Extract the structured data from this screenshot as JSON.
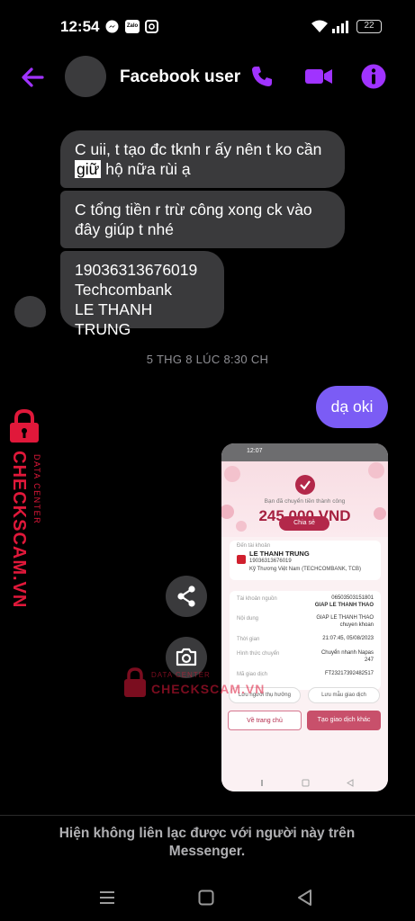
{
  "status_bar": {
    "time": "12:54",
    "battery": "22",
    "icons": [
      "messenger-icon",
      "zalo-icon",
      "instagram-icon",
      "wifi-icon",
      "signal-icon",
      "battery-icon"
    ],
    "zalo_label": "Zalo"
  },
  "header": {
    "contact_name": "Facebook user",
    "accent_color": "#a033ff",
    "icons": [
      "back-arrow-icon",
      "phone-icon",
      "video-camera-icon",
      "info-icon"
    ]
  },
  "messages": {
    "incoming": [
      {
        "text_before": "C uii, t tạo đc tknh r ấy nên t ko cần ",
        "highlight": "giữ",
        "text_after": " hộ nữa rùi ạ"
      },
      {
        "text": "C tổng tiền r trừ công xong ck vào đây giúp t nhé"
      },
      {
        "line1": "19036313676019",
        "line2": "Techcombank",
        "line3": "LE THANH TRUNG"
      }
    ],
    "timestamp": "5 THG 8 LÚC 8:30 CH",
    "outgoing": [
      {
        "text": "dạ oki"
      }
    ],
    "outgoing_color": "#7b5cf5"
  },
  "receipt": {
    "status_time": "12:07",
    "subtitle": "Bạn đã chuyển tiền thành công",
    "amount": "245,000 VND",
    "share_label": "Chia sẻ",
    "to_label": "Đến tài khoản",
    "recipient_name": "LE THANH TRUNG",
    "recipient_account": "19036313676019",
    "recipient_bank": "Kỹ Thương Việt Nam (TECHCOMBANK, TCB)",
    "rows": [
      {
        "label": "Tài khoản nguồn",
        "value": "06503503151801",
        "value2": "GIAP LE THANH THAO"
      },
      {
        "label": "Nội dung",
        "value": "GIAP LE THANH THAO",
        "value2": "chuyen khoan"
      },
      {
        "label": "Thời gian",
        "value": "21:07:45, 05/08/2023",
        "value2": ""
      },
      {
        "label": "Hình thức chuyển",
        "value": "Chuyển nhanh Napas",
        "value2": "247"
      },
      {
        "label": "Mã giao dịch",
        "value": "FT23217392482517",
        "value2": ""
      }
    ],
    "save_beneficiary": "Lưu người thụ hưởng",
    "save_template": "Lưu mẫu giao dịch",
    "home_button": "Về trang chủ",
    "new_transaction_button": "Tạo giao dịch khác",
    "brand_color": "#b3284a"
  },
  "watermark": {
    "small": "DATA CENTER",
    "big": "CHECKSCAM.VN",
    "color": "#e0183a"
  },
  "footer": {
    "unavailable_text": "Hiện không liên lạc được với người này trên Messenger."
  },
  "navbar": {
    "icons": [
      "recent-apps-icon",
      "home-icon",
      "back-icon"
    ]
  }
}
